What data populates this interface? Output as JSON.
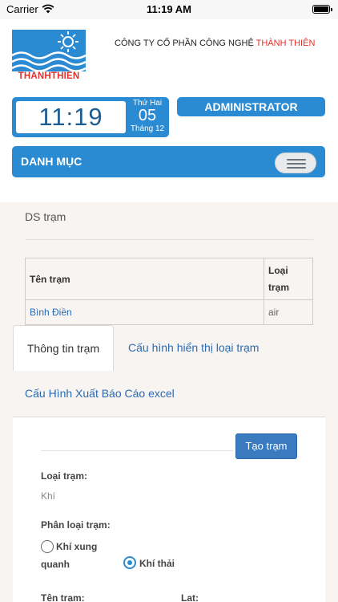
{
  "status_bar": {
    "carrier": "Carrier",
    "time": "11:19 AM"
  },
  "header": {
    "logo_text": "THANHTHIEN",
    "company_prefix": "CÔNG TY CỔ PHẦN CÔNG NGHỆ ",
    "company_highlight": "THÀNH THIÊN",
    "clock": {
      "time": "11:19",
      "weekday": "Thứ Hai",
      "day": "05",
      "month": "Tháng 12"
    },
    "user_role": "ADMINISTRATOR",
    "menu_label": "DANH MỤC"
  },
  "stations": {
    "title": "DS trạm",
    "columns": [
      "Tên trạm",
      "Loại trạm"
    ],
    "rows": [
      {
        "name": "Bình Điền",
        "type": "air"
      }
    ]
  },
  "tabs": [
    {
      "label": "Thông tin trạm",
      "active": true
    },
    {
      "label": "Cấu hình hiển thị loại trạm",
      "active": false
    },
    {
      "label": "Cấu Hình Xuất Báo Cáo excel",
      "active": false
    }
  ],
  "form": {
    "create_button": "Tạo trạm",
    "station_type_label": "Loại trạm:",
    "station_type_value": "Khí",
    "classification_label": "Phân loại trạm:",
    "options": [
      {
        "line1": "Khí xung",
        "line2": "quanh",
        "selected": false
      },
      {
        "label": "Khí thải",
        "selected": true
      }
    ],
    "station_name_label": "Tên trạm:",
    "lat_label": "Lat:"
  },
  "colors": {
    "primary": "#2a8bd2",
    "accent_red": "#e5302a",
    "link": "#2a6ab3"
  }
}
